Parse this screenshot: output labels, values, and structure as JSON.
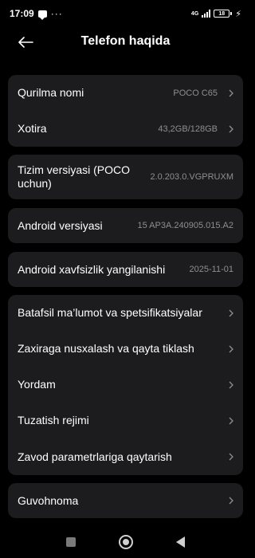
{
  "status_bar": {
    "time": "17:09",
    "more": "···",
    "network": "4G",
    "battery": "18",
    "icons": [
      "message-icon",
      "signal-icon",
      "battery-icon",
      "charging-bolt-icon"
    ]
  },
  "header": {
    "title": "Telefon haqida",
    "back_icon": "arrow-left-icon"
  },
  "cards": {
    "device": {
      "device_name_label": "Qurilma nomi",
      "device_name_value": "POCO C65",
      "storage_label": "Xotira",
      "storage_value": "43,2GB/128GB"
    },
    "os": {
      "label": "Tizim versiyasi (POCO uchun)",
      "value": "2.0.203.0.VGPRUXM"
    },
    "android": {
      "label": "Android versiyasi",
      "value": "15 AP3A.240905.015.A2"
    },
    "security": {
      "label": "Android xavfsizlik yangilanishi",
      "value": "2025-11-01"
    },
    "menu": [
      {
        "label": "Batafsil ma’lumot va spetsifikatsiyalar"
      },
      {
        "label": "Zaxiraga nusxalash va qayta tiklash"
      },
      {
        "label": "Yordam"
      },
      {
        "label": "Tuzatish rejimi"
      },
      {
        "label": "Zavod parametrlariga qaytarish"
      }
    ],
    "certification": {
      "label": "Guvohnoma"
    }
  },
  "nav_bar": {
    "icons": [
      "recents-square-icon",
      "home-circle-icon",
      "back-triangle-icon"
    ]
  },
  "colors": {
    "background": "#000000",
    "card": "#1c1c1e",
    "secondary_text": "#8e8e93"
  }
}
